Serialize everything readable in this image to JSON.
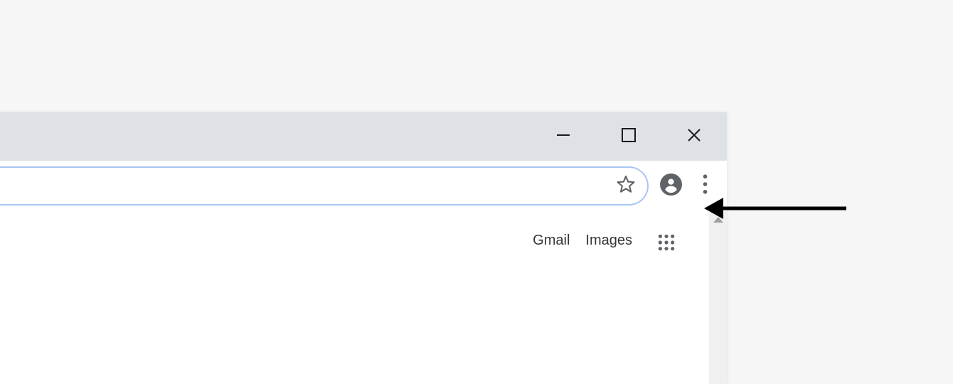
{
  "window_controls": {
    "minimize": "minimize",
    "maximize": "maximize",
    "close": "close"
  },
  "toolbar": {
    "bookmark": "bookmark",
    "profile": "profile",
    "menu": "menu"
  },
  "page": {
    "nav_links": {
      "gmail": "Gmail",
      "images": "Images"
    },
    "apps_launcher": "apps"
  }
}
